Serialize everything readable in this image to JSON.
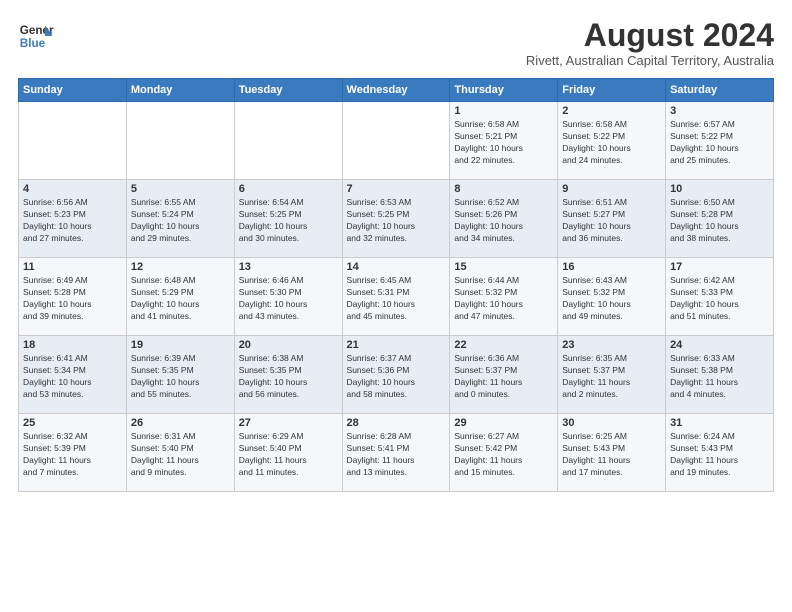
{
  "header": {
    "logo_line1": "General",
    "logo_line2": "Blue",
    "month": "August 2024",
    "location": "Rivett, Australian Capital Territory, Australia"
  },
  "days_of_week": [
    "Sunday",
    "Monday",
    "Tuesday",
    "Wednesday",
    "Thursday",
    "Friday",
    "Saturday"
  ],
  "weeks": [
    [
      {
        "num": "",
        "info": ""
      },
      {
        "num": "",
        "info": ""
      },
      {
        "num": "",
        "info": ""
      },
      {
        "num": "",
        "info": ""
      },
      {
        "num": "1",
        "info": "Sunrise: 6:58 AM\nSunset: 5:21 PM\nDaylight: 10 hours\nand 22 minutes."
      },
      {
        "num": "2",
        "info": "Sunrise: 6:58 AM\nSunset: 5:22 PM\nDaylight: 10 hours\nand 24 minutes."
      },
      {
        "num": "3",
        "info": "Sunrise: 6:57 AM\nSunset: 5:22 PM\nDaylight: 10 hours\nand 25 minutes."
      }
    ],
    [
      {
        "num": "4",
        "info": "Sunrise: 6:56 AM\nSunset: 5:23 PM\nDaylight: 10 hours\nand 27 minutes."
      },
      {
        "num": "5",
        "info": "Sunrise: 6:55 AM\nSunset: 5:24 PM\nDaylight: 10 hours\nand 29 minutes."
      },
      {
        "num": "6",
        "info": "Sunrise: 6:54 AM\nSunset: 5:25 PM\nDaylight: 10 hours\nand 30 minutes."
      },
      {
        "num": "7",
        "info": "Sunrise: 6:53 AM\nSunset: 5:25 PM\nDaylight: 10 hours\nand 32 minutes."
      },
      {
        "num": "8",
        "info": "Sunrise: 6:52 AM\nSunset: 5:26 PM\nDaylight: 10 hours\nand 34 minutes."
      },
      {
        "num": "9",
        "info": "Sunrise: 6:51 AM\nSunset: 5:27 PM\nDaylight: 10 hours\nand 36 minutes."
      },
      {
        "num": "10",
        "info": "Sunrise: 6:50 AM\nSunset: 5:28 PM\nDaylight: 10 hours\nand 38 minutes."
      }
    ],
    [
      {
        "num": "11",
        "info": "Sunrise: 6:49 AM\nSunset: 5:28 PM\nDaylight: 10 hours\nand 39 minutes."
      },
      {
        "num": "12",
        "info": "Sunrise: 6:48 AM\nSunset: 5:29 PM\nDaylight: 10 hours\nand 41 minutes."
      },
      {
        "num": "13",
        "info": "Sunrise: 6:46 AM\nSunset: 5:30 PM\nDaylight: 10 hours\nand 43 minutes."
      },
      {
        "num": "14",
        "info": "Sunrise: 6:45 AM\nSunset: 5:31 PM\nDaylight: 10 hours\nand 45 minutes."
      },
      {
        "num": "15",
        "info": "Sunrise: 6:44 AM\nSunset: 5:32 PM\nDaylight: 10 hours\nand 47 minutes."
      },
      {
        "num": "16",
        "info": "Sunrise: 6:43 AM\nSunset: 5:32 PM\nDaylight: 10 hours\nand 49 minutes."
      },
      {
        "num": "17",
        "info": "Sunrise: 6:42 AM\nSunset: 5:33 PM\nDaylight: 10 hours\nand 51 minutes."
      }
    ],
    [
      {
        "num": "18",
        "info": "Sunrise: 6:41 AM\nSunset: 5:34 PM\nDaylight: 10 hours\nand 53 minutes."
      },
      {
        "num": "19",
        "info": "Sunrise: 6:39 AM\nSunset: 5:35 PM\nDaylight: 10 hours\nand 55 minutes."
      },
      {
        "num": "20",
        "info": "Sunrise: 6:38 AM\nSunset: 5:35 PM\nDaylight: 10 hours\nand 56 minutes."
      },
      {
        "num": "21",
        "info": "Sunrise: 6:37 AM\nSunset: 5:36 PM\nDaylight: 10 hours\nand 58 minutes."
      },
      {
        "num": "22",
        "info": "Sunrise: 6:36 AM\nSunset: 5:37 PM\nDaylight: 11 hours\nand 0 minutes."
      },
      {
        "num": "23",
        "info": "Sunrise: 6:35 AM\nSunset: 5:37 PM\nDaylight: 11 hours\nand 2 minutes."
      },
      {
        "num": "24",
        "info": "Sunrise: 6:33 AM\nSunset: 5:38 PM\nDaylight: 11 hours\nand 4 minutes."
      }
    ],
    [
      {
        "num": "25",
        "info": "Sunrise: 6:32 AM\nSunset: 5:39 PM\nDaylight: 11 hours\nand 7 minutes."
      },
      {
        "num": "26",
        "info": "Sunrise: 6:31 AM\nSunset: 5:40 PM\nDaylight: 11 hours\nand 9 minutes."
      },
      {
        "num": "27",
        "info": "Sunrise: 6:29 AM\nSunset: 5:40 PM\nDaylight: 11 hours\nand 11 minutes."
      },
      {
        "num": "28",
        "info": "Sunrise: 6:28 AM\nSunset: 5:41 PM\nDaylight: 11 hours\nand 13 minutes."
      },
      {
        "num": "29",
        "info": "Sunrise: 6:27 AM\nSunset: 5:42 PM\nDaylight: 11 hours\nand 15 minutes."
      },
      {
        "num": "30",
        "info": "Sunrise: 6:25 AM\nSunset: 5:43 PM\nDaylight: 11 hours\nand 17 minutes."
      },
      {
        "num": "31",
        "info": "Sunrise: 6:24 AM\nSunset: 5:43 PM\nDaylight: 11 hours\nand 19 minutes."
      }
    ]
  ]
}
